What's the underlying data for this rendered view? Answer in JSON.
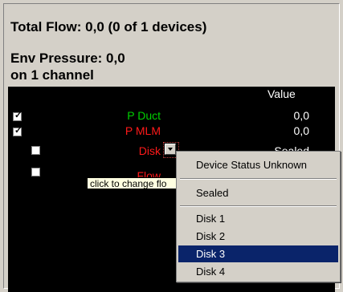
{
  "header": {
    "total_flow": "Total Flow: 0,0 (0 of 1 devices)",
    "env_pressure": "Env Pressure: 0,0",
    "channels": "on 1 channel"
  },
  "grid": {
    "value_header": "Value",
    "rows": [
      {
        "name": "P Duct",
        "value": "0,0",
        "checked": true,
        "color": "#00d000"
      },
      {
        "name": "P MLM",
        "value": "0,0",
        "checked": true,
        "color": "#ff1a1a"
      },
      {
        "name": "Disk",
        "value": "Sealed",
        "checked": false,
        "color": "#ff1a1a"
      },
      {
        "name": "Flow",
        "value": "",
        "checked": false,
        "color": "#ff1a1a"
      }
    ]
  },
  "tooltip": "click to change flo",
  "menu": {
    "items": [
      "Device Status Unknown",
      "Sealed",
      "Disk 1",
      "Disk 2",
      "Disk 3",
      "Disk 4"
    ],
    "selected": "Disk 3"
  }
}
